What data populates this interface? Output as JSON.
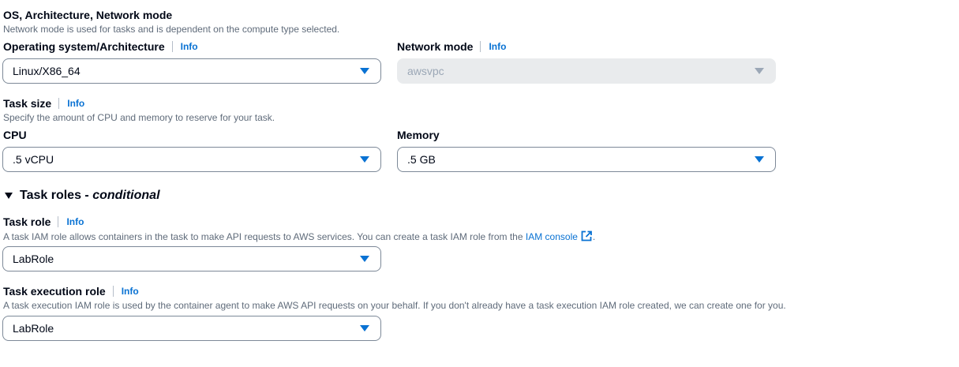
{
  "os_section": {
    "title": "OS, Architecture, Network mode",
    "description": "Network mode is used for tasks and is dependent on the compute type selected.",
    "os_arch": {
      "label": "Operating system/Architecture",
      "info": "Info",
      "value": "Linux/X86_64"
    },
    "network_mode": {
      "label": "Network mode",
      "info": "Info",
      "value": "awsvpc",
      "disabled": true
    }
  },
  "task_size": {
    "title": "Task size",
    "info": "Info",
    "description": "Specify the amount of CPU and memory to reserve for your task.",
    "cpu": {
      "label": "CPU",
      "value": ".5 vCPU"
    },
    "memory": {
      "label": "Memory",
      "value": ".5 GB"
    }
  },
  "task_roles": {
    "expander_prefix": "Task roles - ",
    "expander_suffix": "conditional",
    "task_role": {
      "label": "Task role",
      "info": "Info",
      "description": "A task IAM role allows containers in the task to make API requests to AWS services. You can create a task IAM role from the",
      "link": "IAM console",
      "after_link": ".",
      "value": "LabRole"
    },
    "execution_role": {
      "label": "Task execution role",
      "info": "Info",
      "description": "A task execution IAM role is used by the container agent to make AWS API requests on your behalf. If you don't already have a task execution IAM role created, we can create one for you.",
      "value": "LabRole"
    }
  },
  "icons": {
    "caret": "caret-down-icon",
    "external_link": "external-link-icon",
    "expander": "triangle-down-icon"
  },
  "colors": {
    "accent": "#0972d3",
    "text": "#000716",
    "muted": "#5f6b7a",
    "border": "#7d8998",
    "disabled_bg": "#e9ebed"
  }
}
